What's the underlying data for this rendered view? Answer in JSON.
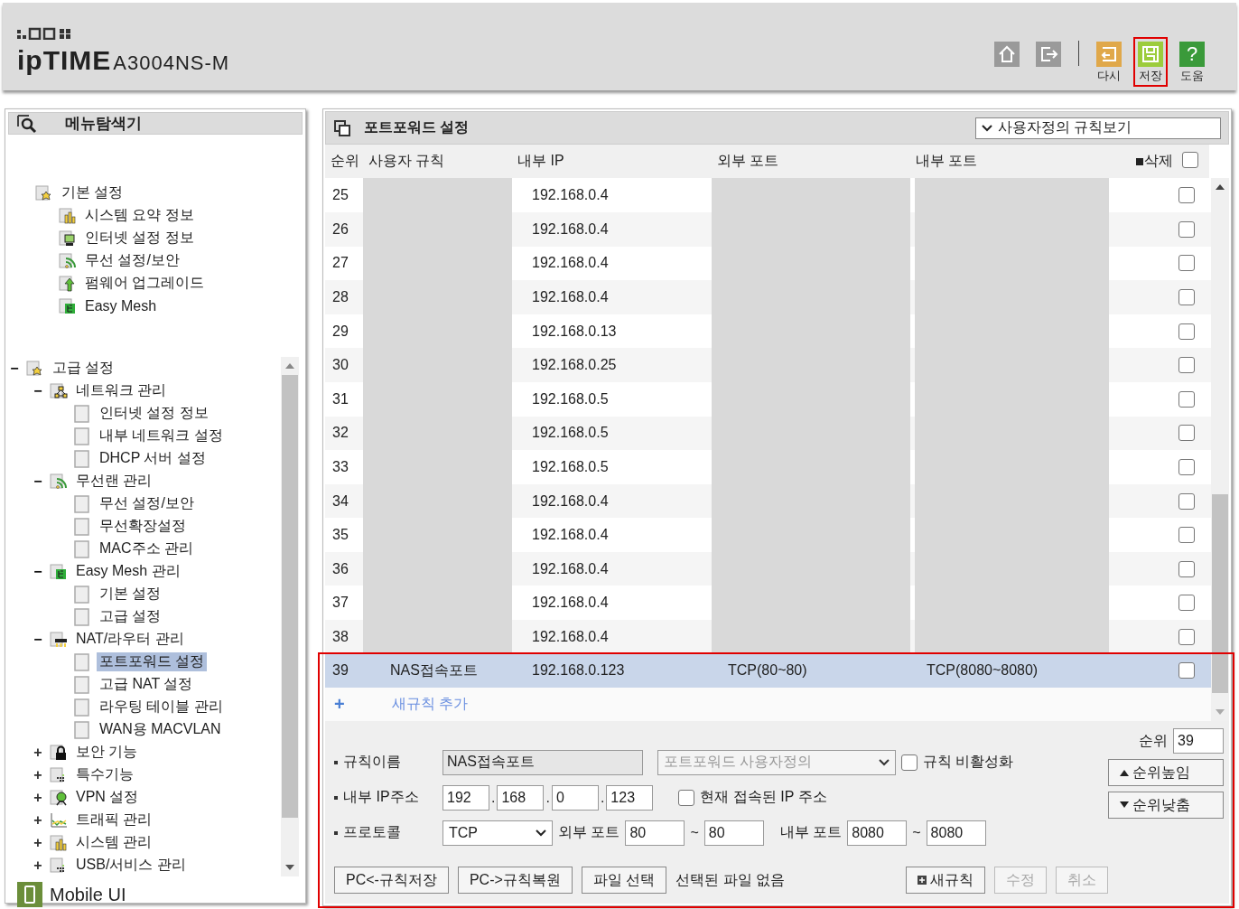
{
  "header": {
    "logo": "ipTIME",
    "model": "A3004NS-M",
    "toolbar": [
      {
        "kind": "home"
      },
      {
        "kind": "logout"
      },
      {
        "kind": "reset",
        "label": "다시",
        "marked": false
      },
      {
        "kind": "save",
        "label": "저장",
        "marked": true
      },
      {
        "kind": "help",
        "label": "도움",
        "glyph": "?",
        "marked": false
      }
    ]
  },
  "sidebar": {
    "title": "메뉴탐색기",
    "groups": [
      {
        "label": "기본 설정",
        "kind": "star",
        "children": [
          {
            "label": "시스템 요약 정보",
            "kind": "chart",
            "selected": false
          },
          {
            "label": "인터넷 설정 정보",
            "kind": "monitor",
            "selected": false
          },
          {
            "label": "무선 설정/보안",
            "kind": "wifi",
            "selected": false
          },
          {
            "label": "펌웨어 업그레이드",
            "kind": "upload",
            "selected": false
          },
          {
            "label": "Easy Mesh",
            "kind": "mesh",
            "selected": false
          }
        ]
      },
      {
        "label": "고급 설정",
        "kind": "star",
        "toggle": "−",
        "expanded": true,
        "children": [
          {
            "label": "네트워크 관리",
            "kind": "network",
            "toggle": "−",
            "expanded": true,
            "children": [
              {
                "label": "인터넷 설정 정보",
                "kind": "blank",
                "selected": false
              },
              {
                "label": "내부 네트워크 설정",
                "kind": "blank",
                "selected": false
              },
              {
                "label": "DHCP 서버 설정",
                "kind": "blank",
                "selected": false
              }
            ]
          },
          {
            "label": "무선랜 관리",
            "kind": "wifi",
            "toggle": "−",
            "expanded": true,
            "children": [
              {
                "label": "무선 설정/보안",
                "kind": "blank",
                "selected": false
              },
              {
                "label": "무선확장설정",
                "kind": "blank",
                "selected": false
              },
              {
                "label": "MAC주소 관리",
                "kind": "blank",
                "selected": false
              }
            ]
          },
          {
            "label": "Easy Mesh 관리",
            "kind": "mesh",
            "toggle": "−",
            "expanded": true,
            "children": [
              {
                "label": "기본 설정",
                "kind": "blank",
                "selected": false
              },
              {
                "label": "고급 설정",
                "kind": "blank",
                "selected": false
              }
            ]
          },
          {
            "label": "NAT/라우터 관리",
            "kind": "router",
            "toggle": "−",
            "expanded": true,
            "children": [
              {
                "label": "포트포워드 설정",
                "kind": "blank",
                "selected": true
              },
              {
                "label": "고급 NAT 설정",
                "kind": "blank",
                "selected": false
              },
              {
                "label": "라우팅 테이블 관리",
                "kind": "blank",
                "selected": false
              },
              {
                "label": "WAN용 MACVLAN",
                "kind": "blank",
                "selected": false
              }
            ]
          },
          {
            "label": "보안 기능",
            "kind": "lock",
            "toggle": "+",
            "expanded": false
          },
          {
            "label": "특수기능",
            "kind": "grid",
            "toggle": "+",
            "expanded": false
          },
          {
            "label": "VPN 설정",
            "kind": "globe",
            "toggle": "+",
            "expanded": false
          },
          {
            "label": "트래픽 관리",
            "kind": "graph",
            "toggle": "+",
            "expanded": false
          },
          {
            "label": "시스템 관리",
            "kind": "chart",
            "toggle": "+",
            "expanded": false
          },
          {
            "label": "USB/서비스 관리",
            "kind": "grid",
            "toggle": "+",
            "expanded": false
          }
        ]
      }
    ],
    "mobile_link": "Mobile UI"
  },
  "main": {
    "title": "포트포워드 설정",
    "view_select": "사용자정의 규칙보기",
    "columns": [
      "순위",
      "사용자 규칙",
      "내부 IP",
      "외부 포트",
      "내부 포트",
      "삭제"
    ],
    "select_all_checked": false,
    "rows": [
      {
        "rank": "25",
        "ip": "192.168.0.4",
        "redacted": true,
        "selected": false,
        "checked": false
      },
      {
        "rank": "26",
        "ip": "192.168.0.4",
        "redacted": true,
        "selected": false,
        "checked": false
      },
      {
        "rank": "27",
        "ip": "192.168.0.4",
        "redacted": true,
        "selected": false,
        "checked": false
      },
      {
        "rank": "28",
        "ip": "192.168.0.4",
        "redacted": true,
        "selected": false,
        "checked": false
      },
      {
        "rank": "29",
        "ip": "192.168.0.13",
        "redacted": true,
        "selected": false,
        "checked": false
      },
      {
        "rank": "30",
        "ip": "192.168.0.25",
        "redacted": true,
        "selected": false,
        "checked": false
      },
      {
        "rank": "31",
        "ip": "192.168.0.5",
        "redacted": true,
        "selected": false,
        "checked": false
      },
      {
        "rank": "32",
        "ip": "192.168.0.5",
        "redacted": true,
        "selected": false,
        "checked": false
      },
      {
        "rank": "33",
        "ip": "192.168.0.5",
        "redacted": true,
        "selected": false,
        "checked": false
      },
      {
        "rank": "34",
        "ip": "192.168.0.4",
        "redacted": true,
        "selected": false,
        "checked": false
      },
      {
        "rank": "35",
        "ip": "192.168.0.4",
        "redacted": true,
        "selected": false,
        "checked": false
      },
      {
        "rank": "36",
        "ip": "192.168.0.4",
        "redacted": true,
        "selected": false,
        "checked": false
      },
      {
        "rank": "37",
        "ip": "192.168.0.4",
        "redacted": true,
        "selected": false,
        "checked": false
      },
      {
        "rank": "38",
        "ip": "192.168.0.4",
        "redacted": true,
        "selected": false,
        "checked": false
      },
      {
        "rank": "39",
        "name": "NAS접속포트",
        "ip": "192.168.0.123",
        "external": "TCP(80~80)",
        "internal": "TCP(8080~8080)",
        "redacted": false,
        "selected": true,
        "checked": false
      }
    ],
    "add_rule": {
      "icon": "+",
      "label": "새규칙 추가"
    },
    "form": {
      "marked": true,
      "name_label": "규칙이름",
      "name_value": "NAS접속포트",
      "preset": "포트포워드 사용자정의",
      "preset_disabled": true,
      "disable_label": "규칙 비활성화",
      "disable_checked": false,
      "ip_label": "내부 IP주소",
      "ip_octets": [
        "192",
        "168",
        "0",
        "123"
      ],
      "ip_separators": [
        ".",
        ".",
        "."
      ],
      "current_ip_label": "현재 접속된 IP 주소",
      "current_ip_checked": false,
      "protocol_label": "프로토콜",
      "protocol": "TCP",
      "external_label": "외부 포트",
      "external_from": "80",
      "external_tilde": "~",
      "external_to": "80",
      "internal_label": "내부 포트",
      "internal_from": "8080",
      "internal_tilde": "~",
      "internal_to": "8080",
      "rank_label": "순위",
      "rank_value": "39",
      "raise_button": "순위높임",
      "lower_button": "순위낮춤",
      "buttons": [
        {
          "label": "PC<-규칙저장",
          "disabled": false
        },
        {
          "label": "PC->규칙복원",
          "disabled": false
        },
        {
          "label": "파일 선택",
          "disabled": false
        }
      ],
      "file_status": "선택된 파일 없음",
      "right_buttons": [
        {
          "label": "새규칙",
          "kind": "new",
          "disabled": false
        },
        {
          "label": "수정",
          "kind": "plain",
          "disabled": true
        },
        {
          "label": "취소",
          "kind": "plain",
          "disabled": true
        }
      ]
    }
  }
}
